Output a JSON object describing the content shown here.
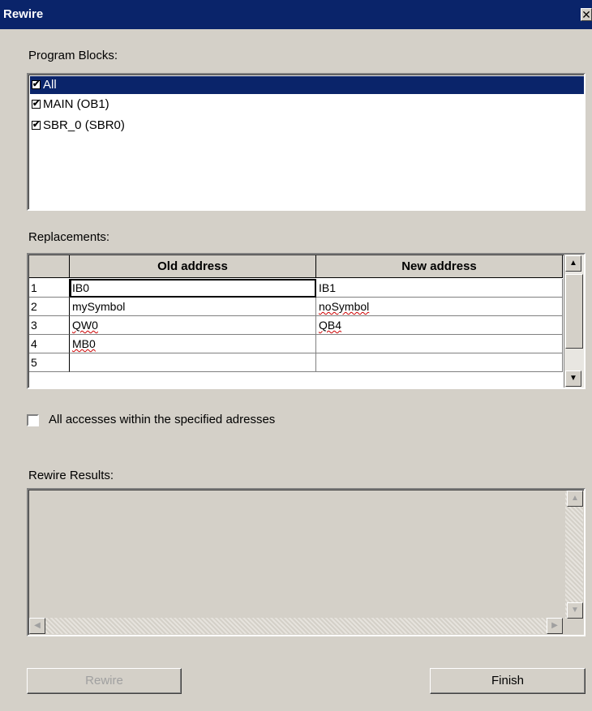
{
  "window": {
    "title": "Rewire",
    "close_glyph": "✕"
  },
  "program_blocks": {
    "label": "Program Blocks:",
    "items": [
      {
        "label": "All",
        "checked": true,
        "selected": true
      },
      {
        "label": "MAIN (OB1)",
        "checked": true,
        "selected": false
      },
      {
        "label": "SBR_0 (SBR0)",
        "checked": true,
        "selected": false
      }
    ]
  },
  "replacements": {
    "label": "Replacements:",
    "columns": [
      "Old address",
      "New address"
    ],
    "rows": [
      {
        "num": "1",
        "old": "IB0",
        "new": "IB1"
      },
      {
        "num": "2",
        "old": "mySymbol",
        "new": "noSymbol"
      },
      {
        "num": "3",
        "old": "QW0",
        "new": "QB4"
      },
      {
        "num": "4",
        "old": "MB0",
        "new": ""
      },
      {
        "num": "5",
        "old": "",
        "new": ""
      }
    ]
  },
  "all_accesses": {
    "label": "All accesses within the specified adresses",
    "checked": false
  },
  "results": {
    "label": "Rewire Results:",
    "text": ""
  },
  "buttons": {
    "rewire": "Rewire",
    "finish": "Finish"
  },
  "icons": {
    "up": "▲",
    "down": "▼",
    "left": "◀",
    "right": "▶",
    "check": "✔"
  }
}
